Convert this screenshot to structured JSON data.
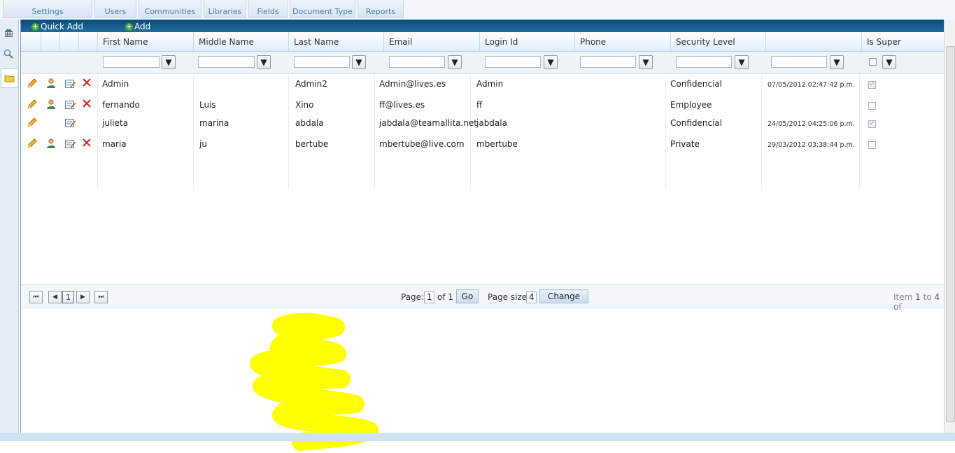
{
  "tabs": [
    "Settings",
    "Users",
    "Communities",
    "Libraries",
    "Fields",
    "Document Type",
    "Reports"
  ],
  "side_icons": [
    "grid-icon",
    "search-icon",
    "folder-icon"
  ],
  "commands": {
    "quick_add": "Quick Add",
    "add": "Add"
  },
  "columns": [
    "First Name",
    "Middle Name",
    "Last Name",
    "Email",
    "Login Id",
    "Phone",
    "Security Level",
    "",
    "Is Super"
  ],
  "rows": [
    {
      "first": "Admin",
      "middle": "",
      "last": "Admin2",
      "email": "Admin@lives.es",
      "login": "Admin",
      "phone": "",
      "security": "Confidencial",
      "date": "07/05/2012 02:47:42 p.m.",
      "is_super": true,
      "has_user_icon": true,
      "has_delete": true
    },
    {
      "first": "fernando",
      "middle": "Luis",
      "last": "Xino",
      "email": "ff@lives.es",
      "login": "ff",
      "phone": "",
      "security": "Employee",
      "date": "",
      "is_super": false,
      "has_user_icon": true,
      "has_delete": true
    },
    {
      "first": "julieta",
      "middle": "marina",
      "last": "abdala",
      "email": "jabdala@teamallita.net",
      "login": "jabdala",
      "phone": "",
      "security": "Confidencial",
      "date": "24/05/2012 04:25:06 p.m.",
      "is_super": true,
      "has_user_icon": false,
      "has_delete": false
    },
    {
      "first": "maria",
      "middle": "ju",
      "last": "bertube",
      "email": "mbertube@live.com",
      "login": "mbertube",
      "phone": "",
      "security": "Private",
      "date": "29/03/2012 03:38:44 p.m.",
      "is_super": false,
      "has_user_icon": true,
      "has_delete": true
    }
  ],
  "pager": {
    "current_page_button": "1",
    "page_label": "Page:",
    "page_value": "1",
    "of_label": "of 1",
    "go_label": "Go",
    "page_size_label": "Page size:",
    "page_size_value": "4",
    "change_label": "Change",
    "item_prefix": "Item",
    "item_from": "1",
    "item_to_word": "to",
    "item_to": "4",
    "item_of": "of"
  },
  "colors": {
    "command_bar": "#0d4d7a",
    "tab_text": "#4a7db4",
    "highlight": "#ffff00",
    "delete_icon": "#e0201b"
  }
}
